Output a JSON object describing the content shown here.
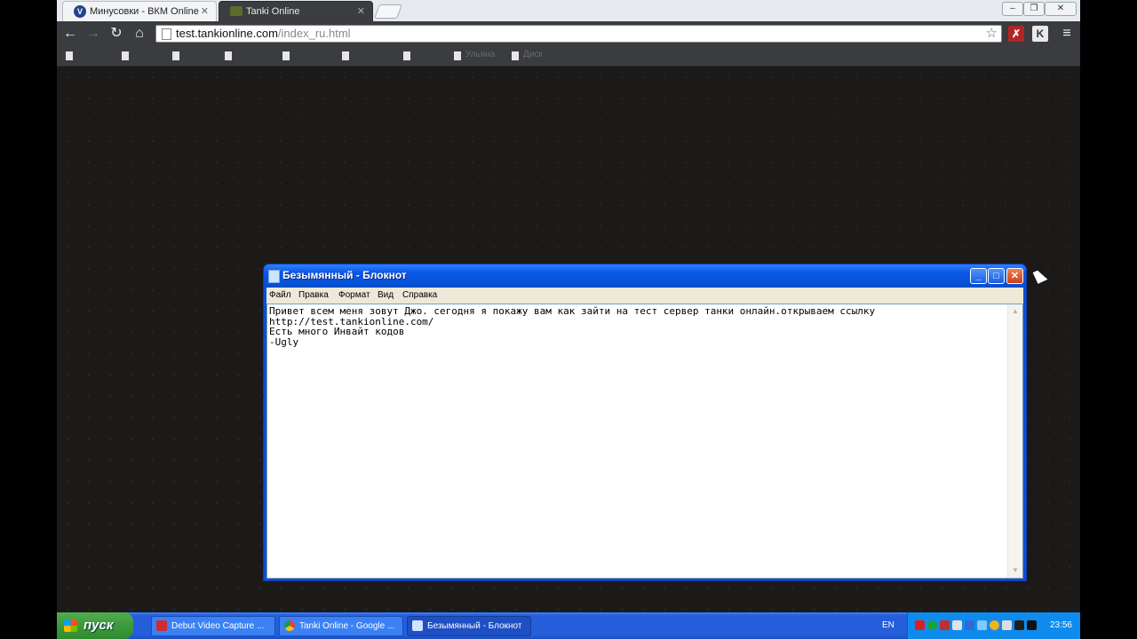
{
  "browser": {
    "tabs": [
      {
        "title": "Минусовки - ВКМ Online",
        "icon": "vkm-favicon"
      },
      {
        "title": "Tanki Online",
        "icon": "tanki-favicon"
      }
    ],
    "address": {
      "host": "test.tankionline.com",
      "path": "/index_ru.html"
    },
    "bookmarks": [
      {
        "label": ""
      },
      {
        "label": ""
      },
      {
        "label": ""
      },
      {
        "label": ""
      },
      {
        "label": ""
      },
      {
        "label": ""
      },
      {
        "label": ""
      },
      {
        "label": "Ульяна"
      },
      {
        "label": "Диск"
      }
    ],
    "extensions": [
      "adblock-extension-icon",
      "k-extension-icon"
    ],
    "ext_k_label": "K"
  },
  "notepad": {
    "title": "Безымянный - Блокнот",
    "menu": [
      "Файл",
      "Правка",
      "Формат",
      "Вид",
      "Справка"
    ],
    "text": "Привет всем меня зовут Джо. сегодня я покажу вам как зайти на тест сервер танки онлайн.открываем ссылку\nhttp://test.tankionline.com/\nЕсть много Инвайт кодов\n-Ugly"
  },
  "taskbar": {
    "start_label": "пуск",
    "tasks": [
      {
        "label": "Debut Video Capture ...",
        "color": "#d22b2b"
      },
      {
        "label": "Tanki Online - Google ...",
        "color": "#e8b01a"
      },
      {
        "label": "Безымянный - Блокнот",
        "color": "#cfe4ff"
      }
    ],
    "language": "EN",
    "clock": "23:56"
  }
}
